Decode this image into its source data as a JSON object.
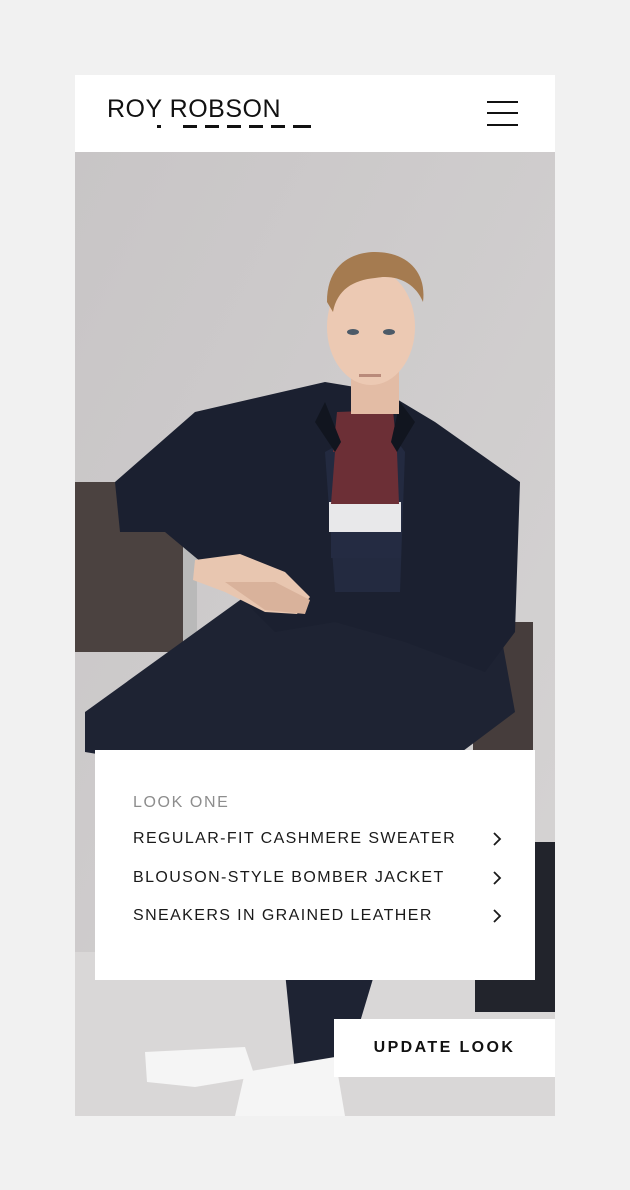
{
  "header": {
    "brand": "ROY ROBSON",
    "menu_icon": "hamburger-menu-icon"
  },
  "look": {
    "title": "LOOK ONE",
    "items": [
      {
        "label": "REGULAR-FIT CASHMERE SWEATER",
        "icon": "chevron-right-icon"
      },
      {
        "label": "BLOUSON-STYLE BOMBER JACKET",
        "icon": "chevron-right-icon"
      },
      {
        "label": "SNEAKERS IN GRAINED LEATHER",
        "icon": "chevron-right-icon"
      }
    ]
  },
  "actions": {
    "update_label": "UPDATE LOOK"
  },
  "colors": {
    "page_bg": "#f1f1f1",
    "wall": "#c9c6c7",
    "navy": "#1c2233",
    "burgundy": "#6c2f36",
    "text": "#111111",
    "muted": "#8d8d8d"
  }
}
